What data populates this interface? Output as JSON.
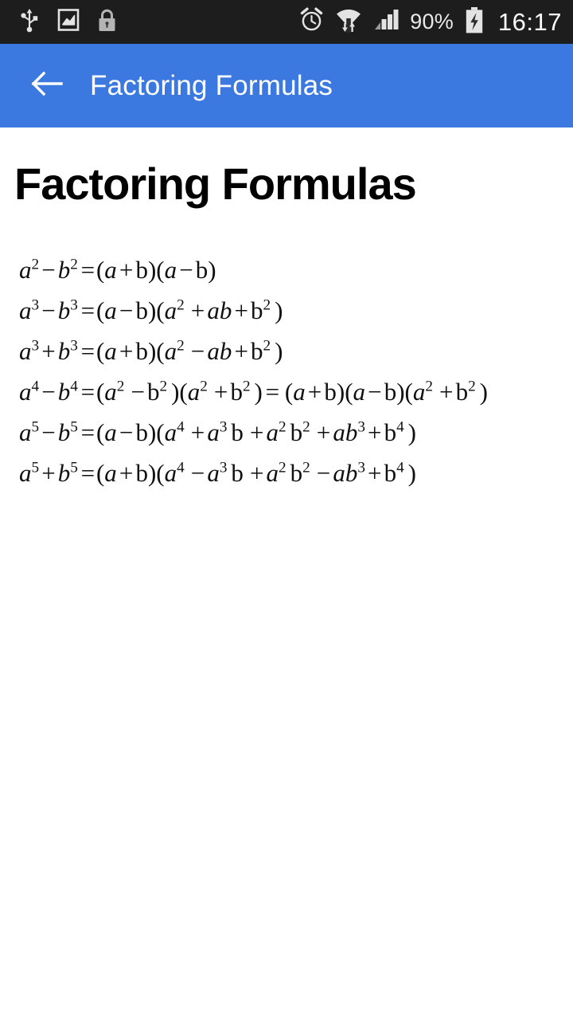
{
  "status_bar": {
    "left_icons": [
      "usb-icon",
      "screenshot-icon",
      "lock-icon"
    ],
    "right_icons": [
      "alarm-icon",
      "wifi-icon",
      "signal-icon",
      "battery-charging-icon"
    ],
    "battery_percent": "90%",
    "time": "16:17",
    "background_color": "#1d1d1d"
  },
  "app_bar": {
    "back_icon": "arrow-left-icon",
    "title": "Factoring Formulas",
    "background_color": "#3b79e0",
    "text_color": "#ffffff"
  },
  "page": {
    "heading": "Factoring Formulas",
    "formulas": [
      {
        "id": "difference-of-squares",
        "plain": "a² − b² = (a+b)(a−b)"
      },
      {
        "id": "difference-of-cubes",
        "plain": "a³ − b³ = (a−b)(a² + ab + b²)"
      },
      {
        "id": "sum-of-cubes",
        "plain": "a³ + b³ = (a+b)(a² − ab + b²)"
      },
      {
        "id": "difference-of-fourth-powers",
        "plain": "a⁴ − b⁴ = (a² − b²)(a² + b²) = (a+b)(a−b)(a² + b²)"
      },
      {
        "id": "difference-of-fifth-powers",
        "plain": "a⁵ − b⁵ = (a−b)(a⁴ + a³b + a²b² + ab³ + b⁴)"
      },
      {
        "id": "sum-of-fifth-powers",
        "plain": "a⁵ + b⁵ = (a+b)(a⁴ − a³b + a²b² − ab³ + b⁴)"
      }
    ]
  }
}
